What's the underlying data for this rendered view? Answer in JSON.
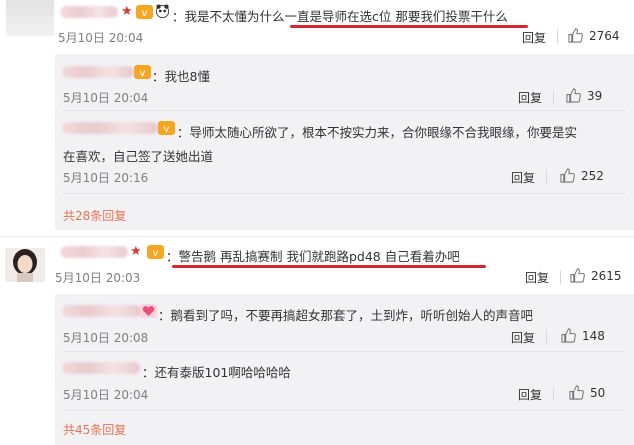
{
  "comments": [
    {
      "text": "：我是不太懂为什么一直是导师在选c位 那要我们投票干什么",
      "time": "5月10日 20:04",
      "reply_label": "回复",
      "likes": "2764",
      "more_replies": "共28条回复",
      "replies": [
        {
          "text": "：我也8懂",
          "time": "5月10日 20:04",
          "reply_label": "回复",
          "likes": "39"
        },
        {
          "text1": "：导师太随心所欲了，根本不按实力来，合你眼缘不合我眼缘，你要是实",
          "text2": "在喜欢，自己签了送她出道",
          "time": "5月10日 20:16",
          "reply_label": "回复",
          "likes": "252"
        }
      ]
    },
    {
      "text": "：警告鹅 再乱搞赛制 我们就跑路pd48 自己看着办吧",
      "time": "5月10日 20:03",
      "reply_label": "回复",
      "likes": "2615",
      "more_replies": "共45条回复",
      "replies": [
        {
          "text": "：鹅看到了吗，不要再搞超女那套了，土到炸，听听创始人的声音吧",
          "time": "5月10日 20:08",
          "reply_label": "回复",
          "likes": "148"
        },
        {
          "text": "：还有泰版101啊哈哈哈哈",
          "time": "5月10日 20:04",
          "reply_label": "回复",
          "likes": "50"
        }
      ]
    }
  ]
}
